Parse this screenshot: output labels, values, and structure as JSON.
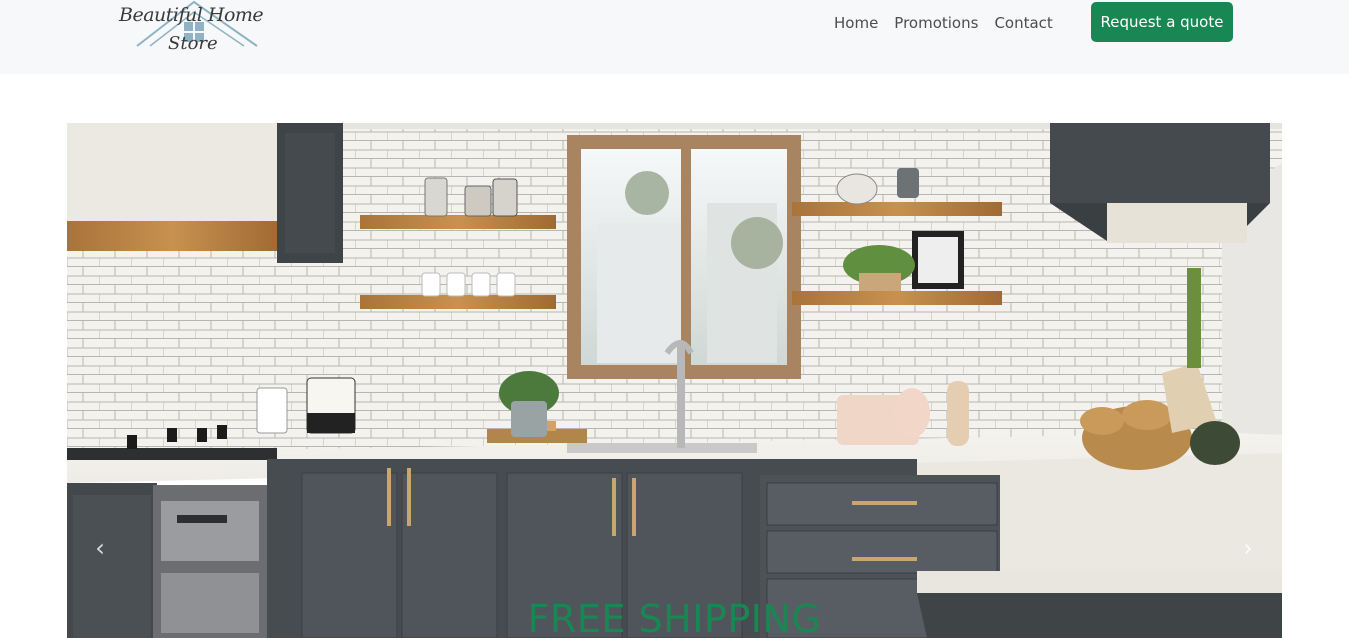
{
  "brand": {
    "name_line1": "Beautiful Home",
    "name_line2": "Store"
  },
  "nav": {
    "items": [
      {
        "label": "Home"
      },
      {
        "label": "Promotions"
      },
      {
        "label": "Contact"
      }
    ],
    "cta_label": "Request a quote"
  },
  "hero": {
    "caption": "FREE SHIPPING",
    "prev_icon": "‹",
    "next_icon": "›"
  },
  "colors": {
    "accent": "#198754",
    "navbar_bg": "#f7f8f9",
    "logo_roof": "#8fb3c4"
  }
}
